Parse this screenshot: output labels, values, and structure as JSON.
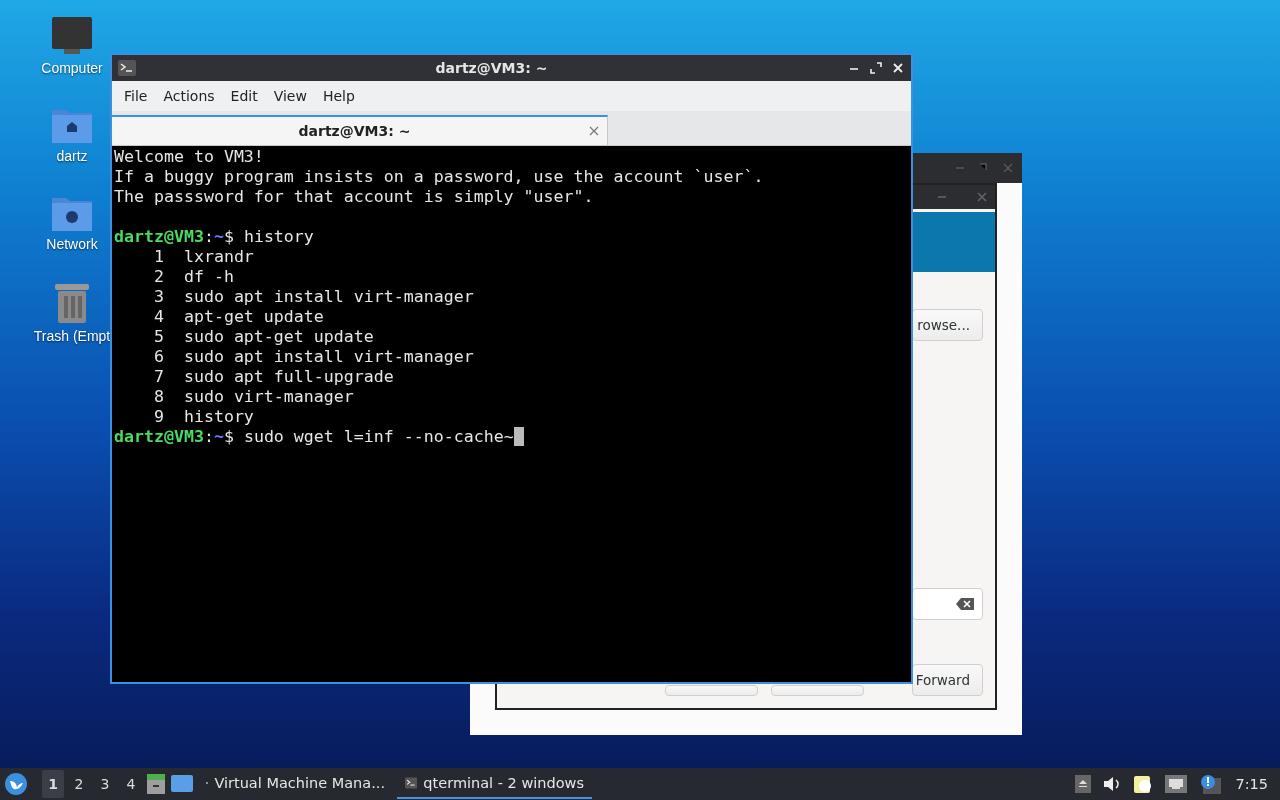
{
  "desktop_icons": [
    {
      "kind": "computer",
      "label": "Computer"
    },
    {
      "kind": "home",
      "label": "dartz"
    },
    {
      "kind": "network",
      "label": "Network"
    },
    {
      "kind": "trash",
      "label": "Trash (Empt"
    }
  ],
  "background_window": {
    "browse_button": "rowse...",
    "forward_button": "Forward"
  },
  "terminal": {
    "title": "dartz@VM3: ~",
    "menu": [
      "File",
      "Actions",
      "Edit",
      "View",
      "Help"
    ],
    "tabs": [
      {
        "label": "dartz@VM3: ~",
        "selected": true
      }
    ],
    "lines": [
      {
        "kind": "output",
        "text": "Welcome to VM3!"
      },
      {
        "kind": "output",
        "text": "If a buggy program insists on a password, use the account `user`."
      },
      {
        "kind": "output",
        "text": "The passsword for that account is simply \"user\"."
      },
      {
        "kind": "blank"
      },
      {
        "kind": "prompt",
        "user": "dartz@VM3",
        "separator": ":",
        "path": "~",
        "symbol": "$",
        "command": "history",
        "cursor": false
      },
      {
        "kind": "output",
        "text": "    1  lxrandr"
      },
      {
        "kind": "output",
        "text": "    2  df -h"
      },
      {
        "kind": "output",
        "text": "    3  sudo apt install virt-manager"
      },
      {
        "kind": "output",
        "text": "    4  apt-get update"
      },
      {
        "kind": "output",
        "text": "    5  sudo apt-get update"
      },
      {
        "kind": "output",
        "text": "    6  sudo apt install virt-manager"
      },
      {
        "kind": "output",
        "text": "    7  sudo apt full-upgrade"
      },
      {
        "kind": "output",
        "text": "    8  sudo virt-manager"
      },
      {
        "kind": "output",
        "text": "    9  history"
      },
      {
        "kind": "prompt",
        "user": "dartz@VM3",
        "separator": ":",
        "path": "~",
        "symbol": "$",
        "command": "sudo wget l=inf --no-cache~",
        "cursor": true
      }
    ]
  },
  "taskbar": {
    "desktops": [
      {
        "label": "1",
        "selected": true
      },
      {
        "label": "2",
        "selected": false
      },
      {
        "label": "3",
        "selected": false
      },
      {
        "label": "4",
        "selected": false
      }
    ],
    "tasks": [
      {
        "kind": "vm",
        "label": "Virtual Machine Mana...",
        "selected": false
      },
      {
        "kind": "terminal",
        "label": "qterminal - 2 windows",
        "selected": true
      }
    ],
    "clock": "7:15"
  }
}
